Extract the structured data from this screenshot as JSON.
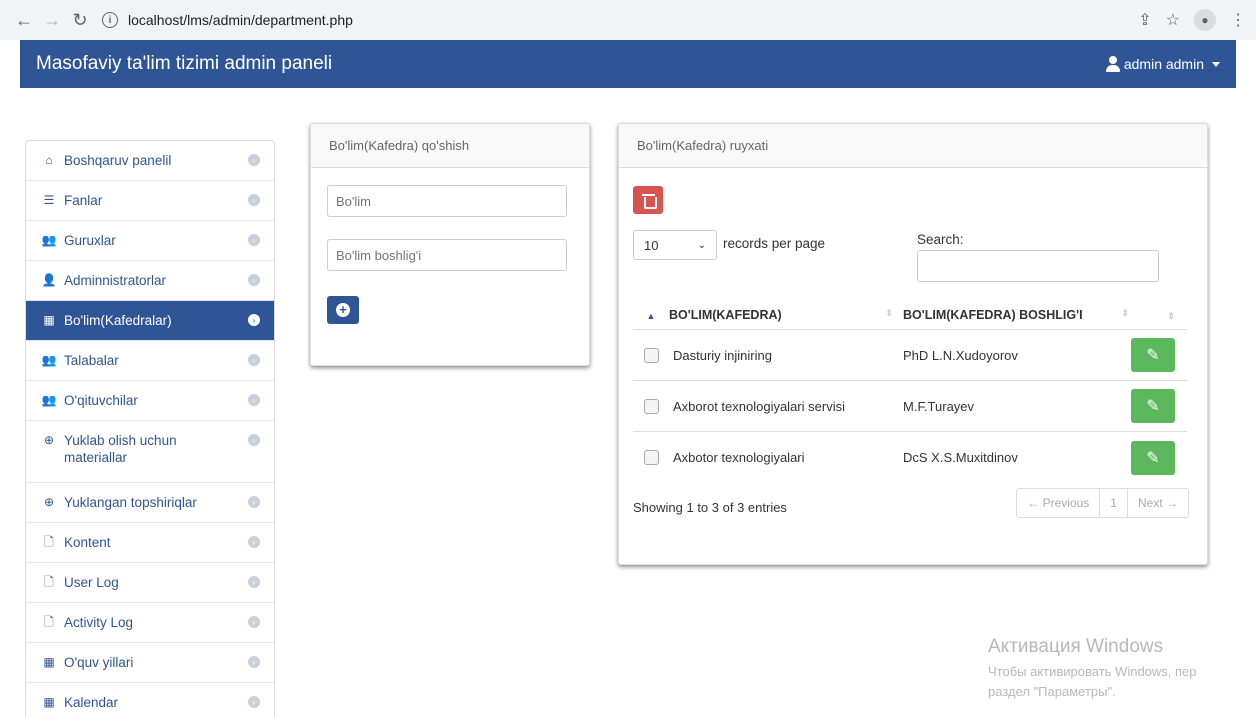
{
  "browser": {
    "url": "localhost/lms/admin/department.php"
  },
  "navbar": {
    "brand": "Masofaviy ta'lim tizimi admin paneli",
    "user": "admin admin"
  },
  "sidebar": {
    "items": [
      {
        "label": "Boshqaruv panelil",
        "icon": "home-icon"
      },
      {
        "label": "Fanlar",
        "icon": "list-icon"
      },
      {
        "label": "Guruxlar",
        "icon": "group-icon"
      },
      {
        "label": "Adminnistratorlar",
        "icon": "user-icon"
      },
      {
        "label": "Bo'lim(Kafedralar)",
        "icon": "building-icon",
        "active": true
      },
      {
        "label": "Talabalar",
        "icon": "group-icon"
      },
      {
        "label": "O'qituvchilar",
        "icon": "group-icon"
      },
      {
        "label": "Yuklab olish uchun materiallar",
        "icon": "download-icon"
      },
      {
        "label": "Yuklangan topshiriqlar",
        "icon": "upload-icon"
      },
      {
        "label": "Kontent",
        "icon": "file-icon"
      },
      {
        "label": "User Log",
        "icon": "file-icon"
      },
      {
        "label": "Activity Log",
        "icon": "file-icon"
      },
      {
        "label": "O'quv yillari",
        "icon": "calendar-icon"
      },
      {
        "label": "Kalendar",
        "icon": "calendar-icon"
      }
    ]
  },
  "add_panel": {
    "title": "Bo'lim(Kafedra) qo'shish",
    "department_placeholder": "Bo'lim",
    "head_placeholder": "Bo'lim boshlig'i"
  },
  "list_panel": {
    "title": "Bo'lim(Kafedra) ruyxati",
    "length_value": "10",
    "length_label": "records per page",
    "search_label": "Search:",
    "columns": [
      "BO'LIM(KAFEDRA)",
      "BO'LIM(KAFEDRA) BOSHLIG'I"
    ],
    "rows": [
      {
        "department": "Dasturiy injiniring",
        "head": "PhD L.N.Xudoyorov"
      },
      {
        "department": "Axborot texnologiyalari servisi",
        "head": "M.F.Turayev"
      },
      {
        "department": "Axbotor texnologiyalari",
        "head": "DcS X.S.Muxitdinov"
      }
    ],
    "info": "Showing 1 to 3 of 3 entries",
    "pager": {
      "previous": "← Previous",
      "page": "1",
      "next": "Next →"
    }
  },
  "watermark": {
    "line1": "Активация Windows",
    "line2": "Чтобы активировать Windows, пер",
    "line3": "раздел \"Параметры\"."
  },
  "colors": {
    "primary": "#2f5597",
    "danger": "#d9534f",
    "success": "#5cb85c"
  }
}
